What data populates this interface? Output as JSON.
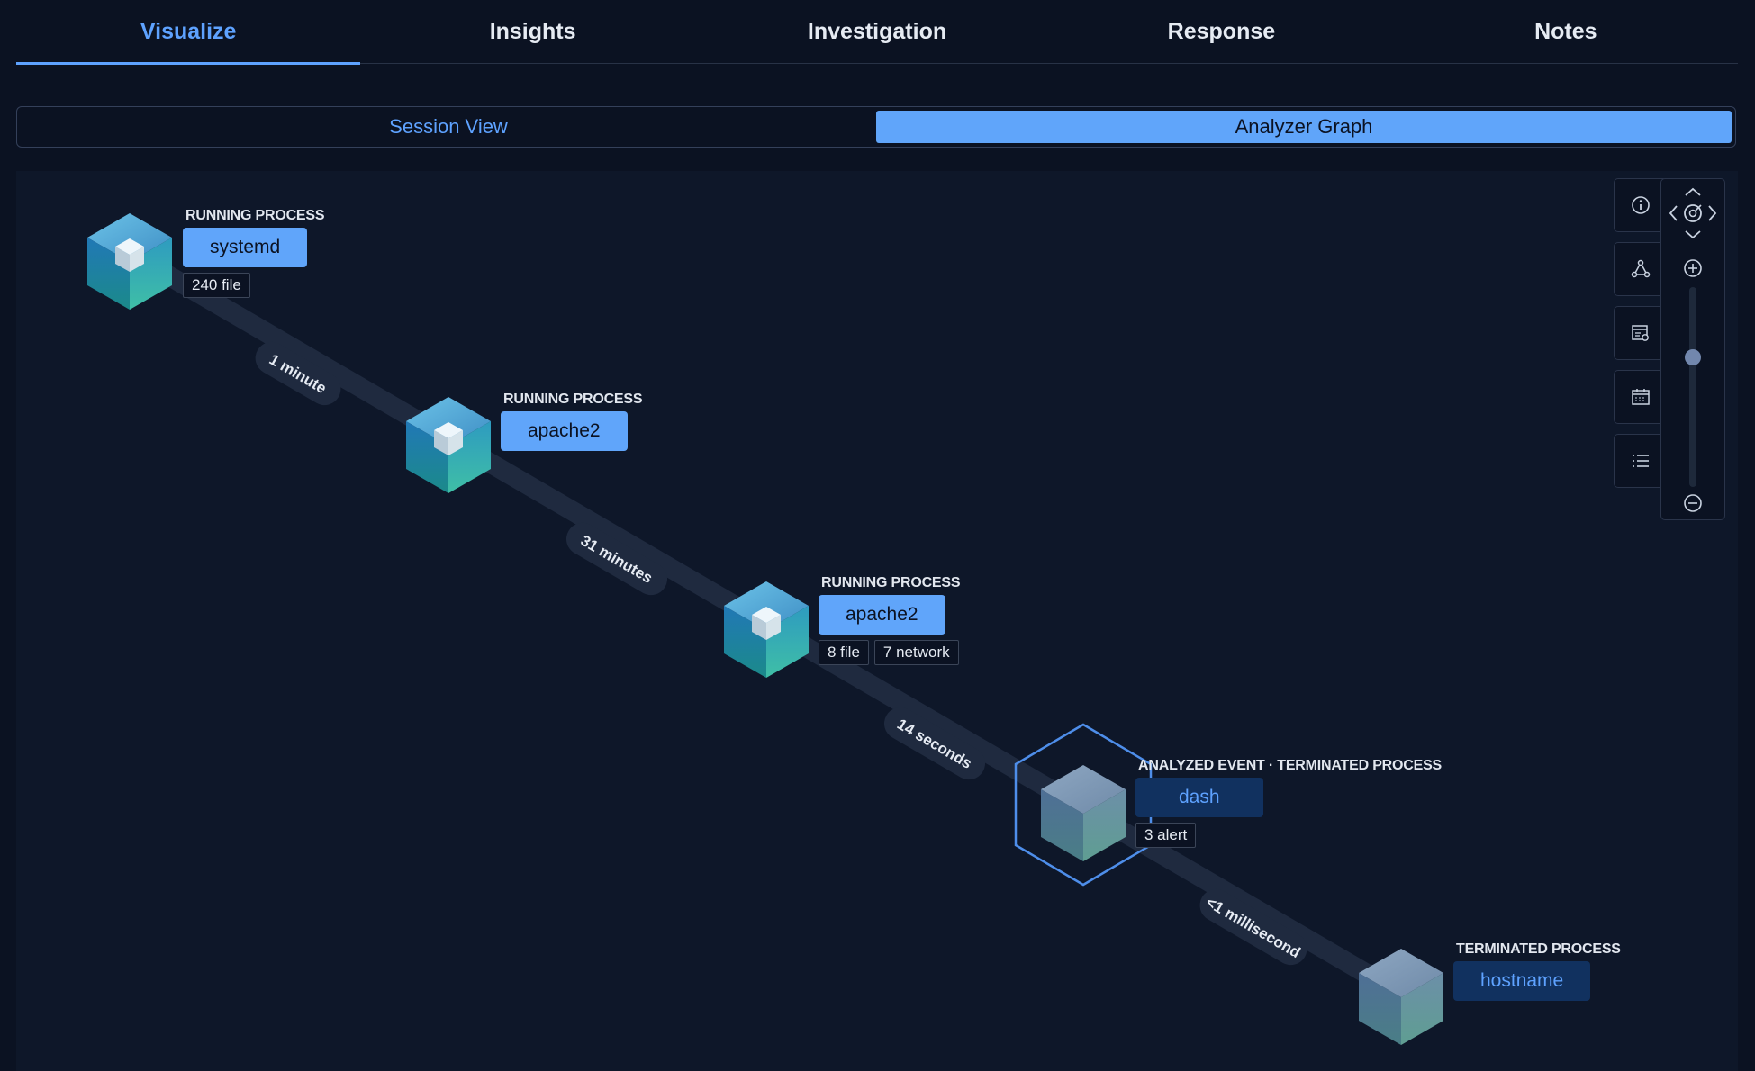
{
  "tabs": [
    "Visualize",
    "Insights",
    "Investigation",
    "Response",
    "Notes"
  ],
  "active_tab": "Visualize",
  "view_toggle": {
    "session_view": "Session View",
    "analyzer_graph": "Analyzer Graph",
    "selected": "Analyzer Graph"
  },
  "nodes": [
    {
      "type_label": "RUNNING PROCESS",
      "name": "systemd",
      "badges": [
        "240 file"
      ]
    },
    {
      "type_label": "RUNNING PROCESS",
      "name": "apache2",
      "badges": []
    },
    {
      "type_label": "RUNNING PROCESS",
      "name": "apache2",
      "badges": [
        "8 file",
        "7 network"
      ]
    },
    {
      "type_label": "ANALYZED EVENT · TERMINATED PROCESS",
      "name": "dash",
      "badges": [
        "3 alert"
      ]
    },
    {
      "type_label": "TERMINATED PROCESS",
      "name": "hostname",
      "badges": []
    }
  ],
  "edges": [
    "1 minute",
    "31 minutes",
    "14 seconds",
    "<1 millisecond"
  ],
  "icons": {
    "info": "info-icon",
    "graph": "graph-nodes-icon",
    "table": "table-settings-icon",
    "calendar": "calendar-icon",
    "list": "list-icon",
    "pan_up": "chevron-up-icon",
    "pan_down": "chevron-down-icon",
    "pan_left": "chevron-left-icon",
    "pan_right": "chevron-right-icon",
    "center": "target-icon",
    "zoom_in": "zoom-in-icon",
    "zoom_out": "zoom-out-icon"
  },
  "zoom_level": 0.66,
  "colors": {
    "accent": "#5ea2ff",
    "pill_active": "#60a5fa",
    "pill_terminated": "#11315f",
    "background": "#0e1729"
  }
}
